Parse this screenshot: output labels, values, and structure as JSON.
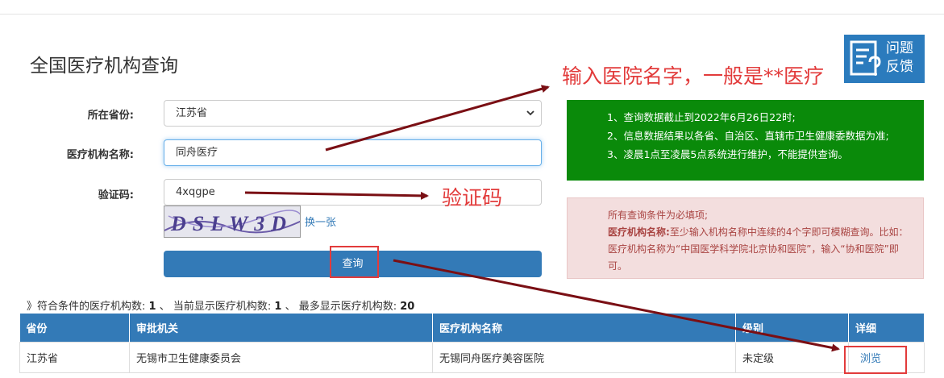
{
  "page": {
    "title": "全国医疗机构查询"
  },
  "form": {
    "province_label": "所在省份:",
    "province_value": "江苏省",
    "name_label": "医疗机构名称:",
    "name_value": "同舟医疗",
    "captcha_label": "验证码:",
    "captcha_value": "4xqgpe",
    "captcha_image_text": "DSLW3D",
    "refresh_label": "换一张",
    "submit_label": "查询"
  },
  "notices": {
    "green": [
      "1、查询数据截止到2022年6月26日22时;",
      "2、信息数据结果以各省、自治区、直辖市卫生健康委数据为准;",
      "3、凌晨1点至凌晨5点系统进行维护，不能提供查询。"
    ],
    "pink_line1": "所有查询条件为必填项;",
    "pink_bold": "医疗机构名称:",
    "pink_rest": "至少输入机构名称中连续的4个字即可模糊查询。比如：医疗机构名称为“中国医学科学院北京协和医院”，输入“协和医院”即可。"
  },
  "feedback": {
    "line1": "问题",
    "line2": "反馈"
  },
  "annotations": {
    "name_hint": "输入医院名字，一般是**医疗",
    "captcha_hint": "验证码"
  },
  "summary": {
    "prefix": "》符合条件的医疗机构数:",
    "matched": "1",
    "sep1": "、 当前显示医疗机构数:",
    "shown": "1",
    "sep2": "、 最多显示医疗机构数:",
    "max": "20"
  },
  "table": {
    "headers": [
      "省份",
      "审批机关",
      "医疗机构名称",
      "级别",
      "详细"
    ],
    "rows": [
      [
        "江苏省",
        "无锡市卫生健康委员会",
        "无锡同舟医疗美容医院",
        "未定级",
        "浏览"
      ]
    ]
  },
  "colors": {
    "primary": "#337ab7",
    "notice_green": "#0a8a0a",
    "annotation_red": "#e23b3b",
    "arrow": "#7a0f14"
  }
}
